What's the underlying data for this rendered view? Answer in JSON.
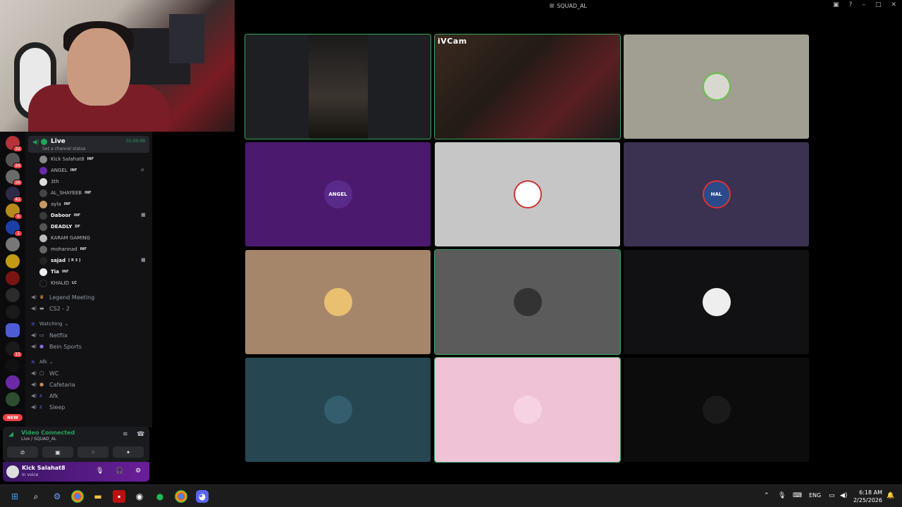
{
  "window": {
    "title": "SQUAD_AL"
  },
  "voice_channel": {
    "name": "Live",
    "timer": "01:00:09",
    "status": "Set a channel status"
  },
  "voice_users": [
    {
      "name": "Kick Salahat8",
      "tag": "INF"
    },
    {
      "name": "ANGEL",
      "tag": "INF"
    },
    {
      "name": "3th",
      "tag": ""
    },
    {
      "name": "AL_SHAYEEB",
      "tag": "INF"
    },
    {
      "name": "ayla",
      "tag": "INF"
    },
    {
      "name": "Daboor",
      "tag": "INF"
    },
    {
      "name": "DEADLY",
      "tag": "DF"
    },
    {
      "name": "KARAM GAMING",
      "tag": ""
    },
    {
      "name": "mohannad",
      "tag": "INF"
    },
    {
      "name": "sajad",
      "tag": "[ R 3 ]"
    },
    {
      "name": "Tia",
      "tag": "INF"
    },
    {
      "name": "KHALID",
      "tag": "LC"
    }
  ],
  "channels": {
    "legend": "Legend Meeting",
    "cs2": "CS2 - 2",
    "watching_cat": "Watching",
    "netflix": "Netflix",
    "bein": "Bein Sports",
    "afk_cat": "Afk",
    "wc": "WC",
    "cafetaria": "Cafetaria",
    "afk": "Afk",
    "sleep": "Sleep"
  },
  "voice_panel": {
    "connected": "Video Connected",
    "location": "Live / SQUAD_AL"
  },
  "user_panel": {
    "name": "Kick Salahat8",
    "status": "In voice"
  },
  "rail": {
    "badges": [
      "32",
      "26",
      "26",
      "42",
      "6",
      "1",
      "15"
    ],
    "new_label": "NEW"
  },
  "tiles": [
    {
      "label": "",
      "color": "#1e1f22",
      "avatar": ""
    },
    {
      "label": "iVCam",
      "color": "#2a1f1a",
      "avatar": ""
    },
    {
      "label": "",
      "color": "#a09f92",
      "avatar": ""
    },
    {
      "label": "",
      "color": "#4b1a6e",
      "avatar": "ANGEL"
    },
    {
      "label": "",
      "color": "#c6c6c6",
      "avatar": ""
    },
    {
      "label": "",
      "color": "#3b3151",
      "avatar": "HAL"
    },
    {
      "label": "",
      "color": "#a6866b",
      "avatar": ""
    },
    {
      "label": "",
      "color": "#5b5b5b",
      "avatar": ""
    },
    {
      "label": "",
      "color": "#111113",
      "avatar": ""
    },
    {
      "label": "",
      "color": "#264652",
      "avatar": ""
    },
    {
      "label": "",
      "color": "#f0c2d6",
      "avatar": ""
    },
    {
      "label": "",
      "color": "#0c0c0d",
      "avatar": ""
    }
  ],
  "taskbar": {
    "lang": "ENG",
    "time": "6:18 AM",
    "date": "2/25/2026"
  },
  "colors": {
    "accent": "#23a55a",
    "badge": "#f23f43",
    "bg": "#000000"
  }
}
